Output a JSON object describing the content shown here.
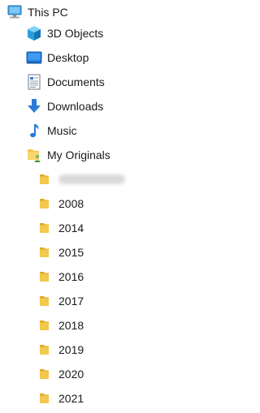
{
  "tree": {
    "this_pc": {
      "label": "This PC",
      "icon": "computer-icon"
    },
    "items": [
      {
        "name": "3d-objects",
        "label": "3D Objects",
        "icon": "cube-icon"
      },
      {
        "name": "desktop",
        "label": "Desktop",
        "icon": "desktop-icon"
      },
      {
        "name": "documents",
        "label": "Documents",
        "icon": "document-icon"
      },
      {
        "name": "downloads",
        "label": "Downloads",
        "icon": "download-arrow-icon"
      },
      {
        "name": "music",
        "label": "Music",
        "icon": "music-note-icon"
      },
      {
        "name": "my-originals",
        "label": "My Originals",
        "icon": "folder-user-icon"
      }
    ],
    "subfolders": [
      {
        "label": "",
        "obscured": true
      },
      {
        "label": "2008"
      },
      {
        "label": "2014"
      },
      {
        "label": "2015"
      },
      {
        "label": "2016"
      },
      {
        "label": "2017"
      },
      {
        "label": "2018"
      },
      {
        "label": "2019"
      },
      {
        "label": "2020"
      },
      {
        "label": "2021"
      }
    ]
  },
  "colors": {
    "folder_yellow": "#f2c94c",
    "folder_shadow": "#e0a929",
    "accent_blue": "#2a7bd6",
    "text": "#1a1a1a"
  }
}
